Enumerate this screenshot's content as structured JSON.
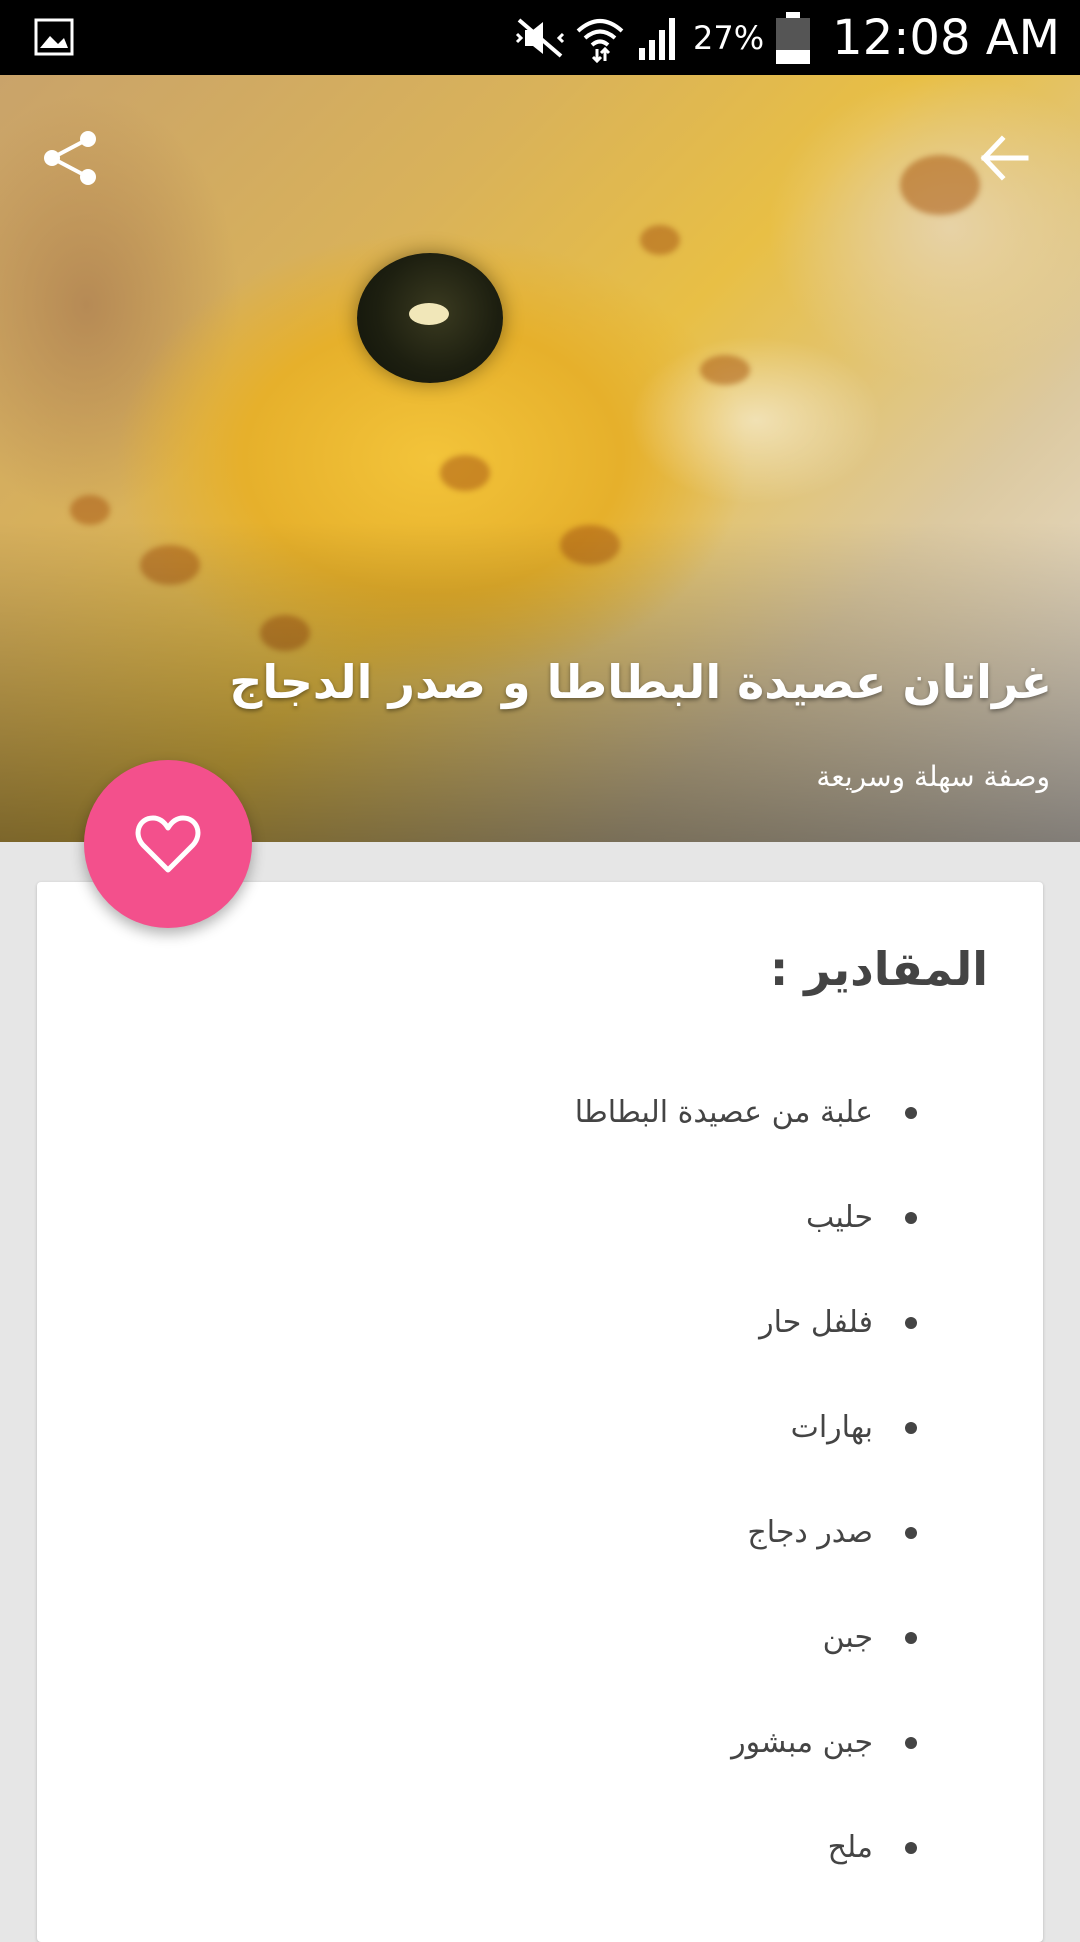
{
  "status_bar": {
    "battery_percent": "27%",
    "time": "12:08 AM"
  },
  "header": {
    "title": "غراتان عصيدة البطاطا و صدر الدجاج",
    "subtitle": "وصفة سهلة وسريعة"
  },
  "ingredients_section": {
    "title": "المقادير :",
    "items": [
      "علبة من عصيدة البطاطا",
      "حليب",
      "فلفل حار",
      "بهارات",
      "صدر دجاج",
      "جبن",
      "جبن مبشور",
      "ملح"
    ]
  },
  "colors": {
    "fab": "#f3508c",
    "status_bar": "#000000",
    "card": "#ffffff",
    "background": "#e6e6e6"
  },
  "icons": [
    "gallery-icon",
    "mute-icon",
    "wifi-icon",
    "signal-icon",
    "battery-icon",
    "back-arrow-icon",
    "share-icon",
    "heart-icon"
  ]
}
